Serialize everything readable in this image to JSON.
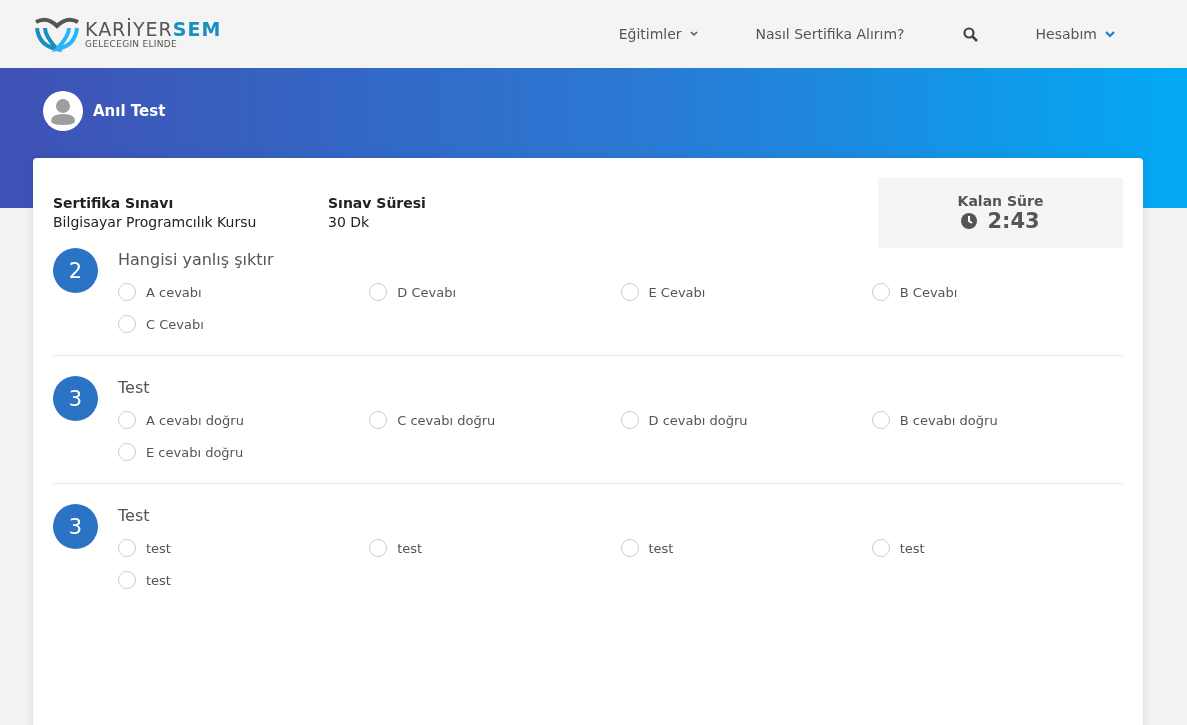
{
  "header": {
    "logo": {
      "name_main": "KARİYER",
      "name_accent": "SEM",
      "tagline": "GELECEGIN ELINDE"
    },
    "nav": [
      {
        "kind": "dropdown",
        "label": "Eğitimler"
      },
      {
        "kind": "link",
        "label": "Nasıl Sertifika Alırım?"
      },
      {
        "kind": "search"
      },
      {
        "kind": "account",
        "label": "Hesabım"
      }
    ]
  },
  "user": {
    "name": "Anıl Test"
  },
  "exam": {
    "info": [
      {
        "label": "Sertifika Sınavı",
        "value": "Bilgisayar Programcılık Kursu"
      },
      {
        "label": "Sınav Süresi",
        "value": "30 Dk"
      }
    ],
    "timer": {
      "label": "Kalan Süre",
      "value": "2:43"
    }
  },
  "questions": [
    {
      "number": "2",
      "text": "Hangisi yanlış şıktır",
      "options": [
        {
          "label": "A cevabı",
          "selected": false
        },
        {
          "label": "D Cevabı",
          "selected": false
        },
        {
          "label": "E Cevabı",
          "selected": false
        },
        {
          "label": "B Cevabı",
          "selected": false
        },
        {
          "label": "C Cevabı",
          "selected": false
        }
      ]
    },
    {
      "number": "3",
      "text": "Test",
      "options": [
        {
          "label": "A cevabı doğru",
          "selected": false
        },
        {
          "label": "C cevabı doğru",
          "selected": false
        },
        {
          "label": "D cevabı doğru",
          "selected": false
        },
        {
          "label": "B cevabı doğru",
          "selected": false
        },
        {
          "label": "E cevabı doğru",
          "selected": false
        }
      ]
    },
    {
      "number": "3",
      "text": "Test",
      "options": [
        {
          "label": "test",
          "selected": false
        },
        {
          "label": "test",
          "selected": false
        },
        {
          "label": "test",
          "selected": false
        },
        {
          "label": "test",
          "selected": false
        },
        {
          "label": "test",
          "selected": false
        }
      ]
    }
  ]
}
